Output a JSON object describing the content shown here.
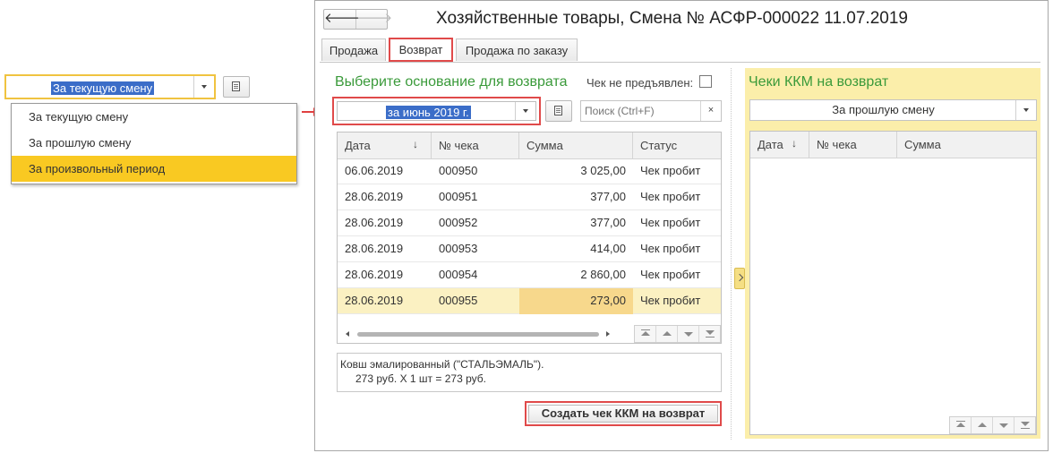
{
  "left_demo": {
    "combo_value": "За текущую смену",
    "options": [
      "За текущую смену",
      "За прошлую смену",
      "За произвольный период"
    ],
    "active_index": 2
  },
  "window": {
    "nav": {
      "back": "🡐",
      "forward": "🡒"
    },
    "title": "Хозяйственные товары, Смена № АСФР-000022  11.07.2019",
    "tabs": [
      "Продажа",
      "Возврат",
      "Продажа по заказу"
    ],
    "active_tab": 1
  },
  "left_panel": {
    "title": "Выберите основание для возврата",
    "checkbox_label": "Чек не предъявлен:",
    "checkbox_checked": false,
    "period_value": "за июнь 2019 г.",
    "search_placeholder": "Поиск (Ctrl+F)",
    "clear_glyph": "×",
    "grid": {
      "columns": [
        "Дата",
        "№ чека",
        "Сумма",
        "Статус"
      ],
      "sort_glyph": "↓",
      "rows": [
        {
          "date": "06.06.2019",
          "number": "000950",
          "sum": "3 025,00",
          "status": "Чек пробит"
        },
        {
          "date": "28.06.2019",
          "number": "000951",
          "sum": "377,00",
          "status": "Чек пробит"
        },
        {
          "date": "28.06.2019",
          "number": "000952",
          "sum": "377,00",
          "status": "Чек пробит"
        },
        {
          "date": "28.06.2019",
          "number": "000953",
          "sum": "414,00",
          "status": "Чек пробит"
        },
        {
          "date": "28.06.2019",
          "number": "000954",
          "sum": "2 860,00",
          "status": "Чек пробит"
        },
        {
          "date": "28.06.2019",
          "number": "000955",
          "sum": "273,00",
          "status": "Чек пробит"
        }
      ],
      "selected_row": 5
    },
    "description": {
      "line1": "Ковш эмалированный (\"СТАЛЬЭМАЛЬ\").",
      "line2": "273 руб. X 1 шт = 273 руб."
    },
    "create_button": "Создать чек ККМ на возврат"
  },
  "right_panel": {
    "title": "Чеки ККМ на возврат",
    "period_value": "За прошлую смену",
    "grid": {
      "columns": [
        "Дата",
        "№ чека",
        "Сумма"
      ],
      "sort_glyph": "↓"
    }
  },
  "colors": {
    "accent_green": "#3a9a3a",
    "highlight_red": "#e04a4a",
    "selection_yellow": "#f9c922",
    "panel_yellow": "#fbeeaa",
    "selection_blue": "#3b6dc8"
  }
}
